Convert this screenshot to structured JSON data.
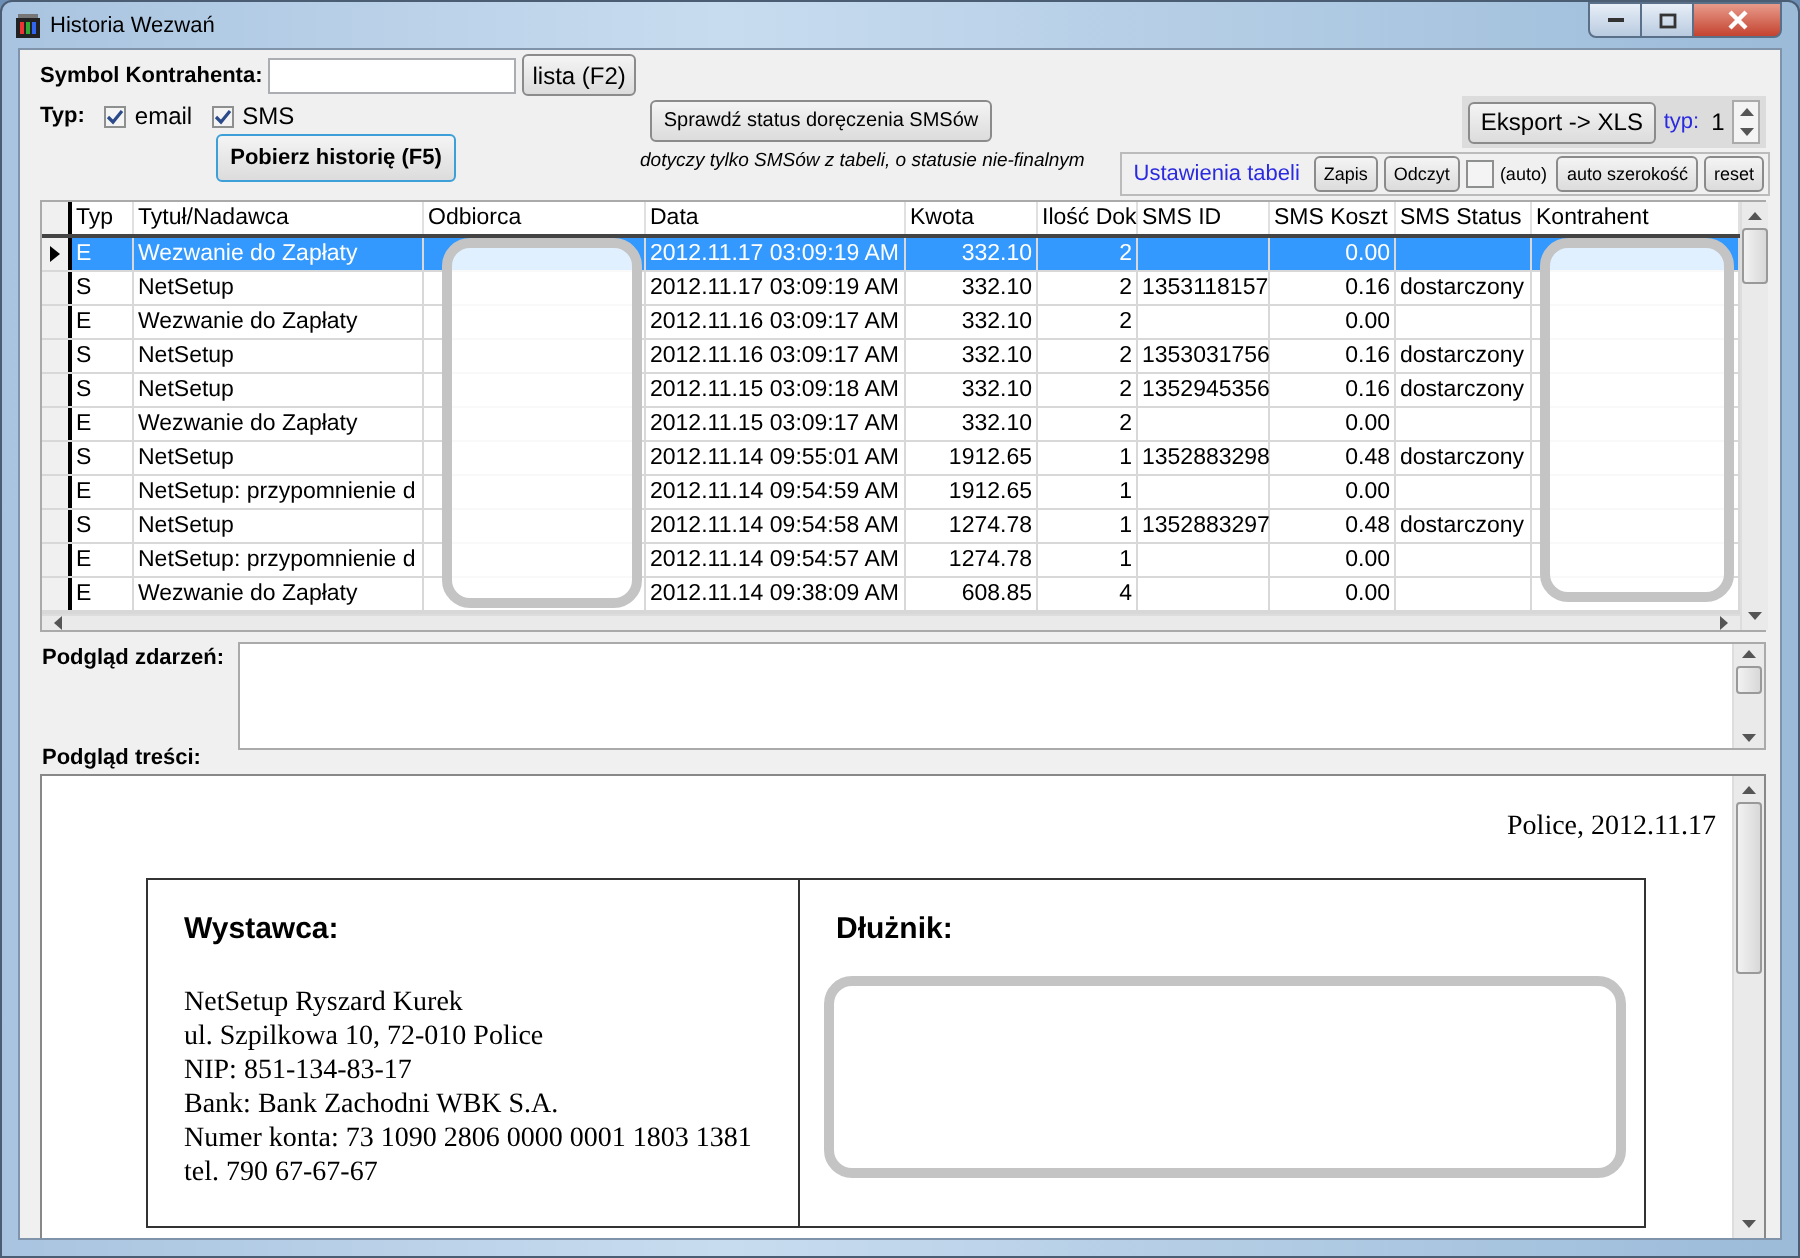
{
  "window": {
    "title": "Historia Wezwań"
  },
  "filter": {
    "symbol_label": "Symbol Kontrahenta:",
    "list_button": "lista (F2)",
    "type_label": "Typ:",
    "types": [
      {
        "label": "email",
        "checked": true
      },
      {
        "label": "SMS",
        "checked": true
      }
    ],
    "fetch_button": "Pobierz historię (F5)"
  },
  "sms_check": {
    "button": "Sprawdź status doręczenia SMSów",
    "note": "dotyczy tylko SMSów z tabeli, o statusie nie-finalnym"
  },
  "export": {
    "button": "Eksport -> XLS",
    "type_label": "typ:",
    "type_value": "1"
  },
  "table_settings": {
    "label": "Ustawienia tabeli",
    "save_button": "Zapis",
    "load_button": "Odczyt",
    "auto_label": "(auto)",
    "auto_checked": false,
    "autowidth_button": "auto szerokość",
    "reset_button": "reset"
  },
  "table": {
    "columns": [
      "Typ",
      "Tytuł/Nadawca",
      "Odbiorca",
      "Data",
      "Kwota",
      "Ilość Dok",
      "SMS ID",
      "SMS Koszt",
      "SMS Status",
      "Kontrahent"
    ],
    "rows": [
      {
        "selected": true,
        "typ": "E",
        "title": "Wezwanie do Zapłaty",
        "date": "2012.11.17 03:09:19 AM",
        "amount": "332.10",
        "docs": "2",
        "sms_id": "",
        "cost": "0.00",
        "status": ""
      },
      {
        "selected": false,
        "typ": "S",
        "title": "NetSetup",
        "date": "2012.11.17 03:09:19 AM",
        "amount": "332.10",
        "docs": "2",
        "sms_id": "1353118157",
        "cost": "0.16",
        "status": "dostarczony"
      },
      {
        "selected": false,
        "typ": "E",
        "title": "Wezwanie do Zapłaty",
        "date": "2012.11.16 03:09:17 AM",
        "amount": "332.10",
        "docs": "2",
        "sms_id": "",
        "cost": "0.00",
        "status": ""
      },
      {
        "selected": false,
        "typ": "S",
        "title": "NetSetup",
        "date": "2012.11.16 03:09:17 AM",
        "amount": "332.10",
        "docs": "2",
        "sms_id": "1353031756",
        "cost": "0.16",
        "status": "dostarczony"
      },
      {
        "selected": false,
        "typ": "S",
        "title": "NetSetup",
        "date": "2012.11.15 03:09:18 AM",
        "amount": "332.10",
        "docs": "2",
        "sms_id": "1352945356",
        "cost": "0.16",
        "status": "dostarczony"
      },
      {
        "selected": false,
        "typ": "E",
        "title": "Wezwanie do Zapłaty",
        "date": "2012.11.15 03:09:17 AM",
        "amount": "332.10",
        "docs": "2",
        "sms_id": "",
        "cost": "0.00",
        "status": ""
      },
      {
        "selected": false,
        "typ": "S",
        "title": "NetSetup",
        "date": "2012.11.14 09:55:01 AM",
        "amount": "1912.65",
        "docs": "1",
        "sms_id": "1352883298",
        "cost": "0.48",
        "status": "dostarczony"
      },
      {
        "selected": false,
        "typ": "E",
        "title": "NetSetup: przypomnienie d",
        "date": "2012.11.14 09:54:59 AM",
        "amount": "1912.65",
        "docs": "1",
        "sms_id": "",
        "cost": "0.00",
        "status": ""
      },
      {
        "selected": false,
        "typ": "S",
        "title": "NetSetup",
        "date": "2012.11.14 09:54:58 AM",
        "amount": "1274.78",
        "docs": "1",
        "sms_id": "1352883297",
        "cost": "0.48",
        "status": "dostarczony"
      },
      {
        "selected": false,
        "typ": "E",
        "title": "NetSetup: przypomnienie d",
        "date": "2012.11.14 09:54:57 AM",
        "amount": "1274.78",
        "docs": "1",
        "sms_id": "",
        "cost": "0.00",
        "status": ""
      },
      {
        "selected": false,
        "typ": "E",
        "title": "Wezwanie do Zapłaty",
        "date": "2012.11.14 09:38:09 AM",
        "amount": "608.85",
        "docs": "4",
        "sms_id": "",
        "cost": "0.00",
        "status": ""
      }
    ]
  },
  "events_preview": {
    "label": "Podgląd zdarzeń:"
  },
  "content_preview": {
    "label": "Podgląd treści:",
    "place_date": "Police, 2012.11.17",
    "issuer": {
      "heading": "Wystawca:",
      "lines": [
        "NetSetup Ryszard Kurek",
        "ul. Szpilkowa 10, 72-010 Police",
        "NIP: 851-134-83-17",
        "Bank: Bank Zachodni WBK S.A.",
        "Numer konta: 73 1090 2806 0000 0001 1803 1381",
        "tel. 790 67-67-67"
      ]
    },
    "debtor": {
      "heading": "Dłużnik:"
    }
  }
}
